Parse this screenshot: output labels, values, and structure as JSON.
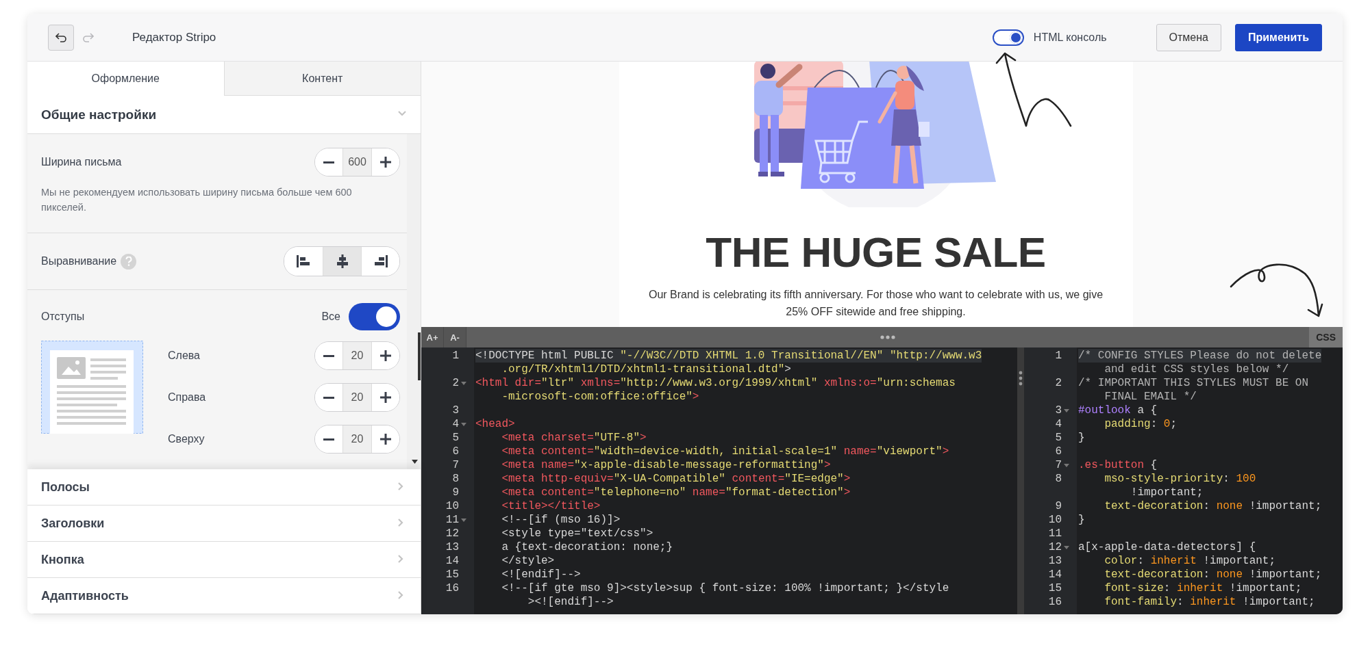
{
  "header": {
    "undo": {
      "disabled": false
    },
    "redo": {
      "disabled": true
    },
    "title": "Редактор Stripo",
    "console_toggle": {
      "label": "HTML консоль",
      "on": true
    },
    "buttons": [
      {
        "label": "Отмена",
        "kind": "secondary"
      },
      {
        "label": "Применить",
        "kind": "primary"
      }
    ]
  },
  "left_panel": {
    "tabs": [
      {
        "label": "Оформление",
        "selected": true
      },
      {
        "label": "Контент",
        "selected": false
      }
    ],
    "general": {
      "title": "Общие настройки",
      "expanded": true,
      "email_width": {
        "label": "Ширина письма",
        "value": "600",
        "hint": "Мы не рекомендуем использовать ширину письма больше чем 600 пикселей."
      },
      "alignment": {
        "label": "Выравнивание",
        "options": [
          {
            "kind": "left",
            "selected": false
          },
          {
            "kind": "center",
            "selected": true
          },
          {
            "kind": "right",
            "selected": false
          }
        ]
      },
      "paddings": {
        "label": "Отступы",
        "toggle": {
          "label": "Все",
          "on": true
        },
        "fields": [
          {
            "label": "Слева",
            "value": "20"
          },
          {
            "label": "Справа",
            "value": "20"
          },
          {
            "label": "Сверху",
            "value": "20"
          }
        ]
      }
    },
    "sections": [
      {
        "title": "Полосы",
        "expanded": false
      },
      {
        "title": "Заголовки",
        "expanded": false
      },
      {
        "title": "Кнопка",
        "expanded": false
      },
      {
        "title": "Адаптивность",
        "expanded": false
      }
    ]
  },
  "preview": {
    "title": "THE HUGE SALE",
    "text": "Our Brand is celebrating its fifth anniversary. For those who want to celebrate with us, we give 25% OFF sitewide and free shipping."
  },
  "code_editor": {
    "toolbar": {
      "buttons": [
        "A+",
        "A-"
      ],
      "css_tab": "CSS"
    },
    "html": {
      "lines": [
        {
          "n": "1",
          "fold": false,
          "active": true,
          "rows": [
            {
              "tokens": [
                {
                  "kind": "plain",
                  "text": "<!DOCTYPE html PUBLIC "
                },
                {
                  "kind": "string",
                  "text": "\"-//W3C//DTD XHTML 1.0 Transitional//EN\" \"http://www.w3"
                }
              ]
            },
            {
              "tokens": [
                {
                  "kind": "string",
                  "text": ".org/TR/xhtml1/DTD/xhtml1-transitional.dtd\""
                },
                {
                  "kind": "plain",
                  "text": ">"
                }
              ]
            }
          ]
        },
        {
          "n": "2",
          "fold": true,
          "active": false,
          "rows": [
            {
              "tokens": [
                {
                  "kind": "tag",
                  "text": "<html "
                },
                {
                  "kind": "attr",
                  "text": "dir="
                },
                {
                  "kind": "string",
                  "text": "\"ltr\" "
                },
                {
                  "kind": "attr",
                  "text": "xmlns="
                },
                {
                  "kind": "string",
                  "text": "\"http://www.w3.org/1999/xhtml\" "
                },
                {
                  "kind": "attr",
                  "text": "xmlns:o="
                },
                {
                  "kind": "string",
                  "text": "\"urn:schemas"
                }
              ]
            },
            {
              "tokens": [
                {
                  "kind": "string",
                  "text": "-microsoft-com:office:office\""
                },
                {
                  "kind": "tag",
                  "text": ">"
                }
              ]
            }
          ]
        },
        {
          "n": "3",
          "fold": false,
          "active": false
        },
        {
          "n": "4",
          "fold": true,
          "active": false,
          "rows": [
            {
              "tokens": [
                {
                  "kind": "tag",
                  "text": "<head>"
                }
              ]
            }
          ]
        },
        {
          "n": "5",
          "fold": false,
          "active": false,
          "rows": [
            {
              "tokens": [
                {
                  "kind": "tag",
                  "text": "    <meta "
                },
                {
                  "kind": "attr",
                  "text": "charset="
                },
                {
                  "kind": "string",
                  "text": "\"UTF-8\""
                },
                {
                  "kind": "tag",
                  "text": ">"
                }
              ]
            }
          ]
        },
        {
          "n": "6",
          "fold": false,
          "active": false,
          "rows": [
            {
              "tokens": [
                {
                  "kind": "tag",
                  "text": "    <meta "
                },
                {
                  "kind": "attr",
                  "text": "content="
                },
                {
                  "kind": "string",
                  "text": "\"width=device-width, initial-scale=1\" "
                },
                {
                  "kind": "attr",
                  "text": "name="
                },
                {
                  "kind": "string",
                  "text": "\"viewport\""
                },
                {
                  "kind": "tag",
                  "text": ">"
                }
              ]
            }
          ]
        },
        {
          "n": "7",
          "fold": false,
          "active": false,
          "rows": [
            {
              "tokens": [
                {
                  "kind": "tag",
                  "text": "    <meta "
                },
                {
                  "kind": "attr",
                  "text": "name="
                },
                {
                  "kind": "string",
                  "text": "\"x-apple-disable-message-reformatting\""
                },
                {
                  "kind": "tag",
                  "text": ">"
                }
              ]
            }
          ]
        },
        {
          "n": "8",
          "fold": false,
          "active": false,
          "rows": [
            {
              "tokens": [
                {
                  "kind": "tag",
                  "text": "    <meta "
                },
                {
                  "kind": "attr",
                  "text": "http-equiv="
                },
                {
                  "kind": "string",
                  "text": "\"X-UA-Compatible\" "
                },
                {
                  "kind": "attr",
                  "text": "content="
                },
                {
                  "kind": "string",
                  "text": "\"IE=edge\""
                },
                {
                  "kind": "tag",
                  "text": ">"
                }
              ]
            }
          ]
        },
        {
          "n": "9",
          "fold": false,
          "active": false,
          "rows": [
            {
              "tokens": [
                {
                  "kind": "tag",
                  "text": "    <meta "
                },
                {
                  "kind": "attr",
                  "text": "content="
                },
                {
                  "kind": "string",
                  "text": "\"telephone=no\" "
                },
                {
                  "kind": "attr",
                  "text": "name="
                },
                {
                  "kind": "string",
                  "text": "\"format-detection\""
                },
                {
                  "kind": "tag",
                  "text": ">"
                }
              ]
            }
          ]
        },
        {
          "n": "10",
          "fold": false,
          "active": false,
          "rows": [
            {
              "tokens": [
                {
                  "kind": "tag",
                  "text": "    <title></title>"
                }
              ]
            }
          ]
        },
        {
          "n": "11",
          "fold": true,
          "active": false,
          "rows": [
            {
              "tokens": [
                {
                  "kind": "plain",
                  "text": "    <!--[if (mso 16)]>"
                }
              ]
            }
          ]
        },
        {
          "n": "12",
          "fold": false,
          "active": false,
          "rows": [
            {
              "tokens": [
                {
                  "kind": "plain",
                  "text": "    <style type=\"text/css\">"
                }
              ]
            }
          ]
        },
        {
          "n": "13",
          "fold": false,
          "active": false,
          "rows": [
            {
              "tokens": [
                {
                  "kind": "plain",
                  "text": "    a {text-decoration: none;}"
                }
              ]
            }
          ]
        },
        {
          "n": "14",
          "fold": false,
          "active": false,
          "rows": [
            {
              "tokens": [
                {
                  "kind": "plain",
                  "text": "    </style>"
                }
              ]
            }
          ]
        },
        {
          "n": "15",
          "fold": false,
          "active": false,
          "rows": [
            {
              "tokens": [
                {
                  "kind": "plain",
                  "text": "    <![endif]-->"
                }
              ]
            }
          ]
        },
        {
          "n": "16",
          "fold": false,
          "active": false,
          "rows": [
            {
              "tokens": [
                {
                  "kind": "plain",
                  "text": "    <!--[if gte mso 9]><style>sup { font-size: 100% !important; }</style"
                }
              ]
            },
            {
              "tokens": [
                {
                  "kind": "plain",
                  "text": "    ><![endif]-->"
                }
              ]
            }
          ]
        }
      ]
    },
    "css": {
      "lines": [
        {
          "n": "1",
          "fold": false,
          "active": true,
          "rows": [
            {
              "tokens": [
                {
                  "kind": "comment",
                  "text": "/* CONFIG STYLES Please do not delete"
                }
              ]
            },
            {
              "tokens": [
                {
                  "kind": "comment",
                  "text": "and edit CSS styles below */"
                }
              ]
            }
          ]
        },
        {
          "n": "2",
          "fold": false,
          "active": false,
          "rows": [
            {
              "tokens": [
                {
                  "kind": "comment",
                  "text": "/* IMPORTANT THIS STYLES MUST BE ON"
                }
              ]
            },
            {
              "tokens": [
                {
                  "kind": "comment",
                  "text": "FINAL EMAIL */"
                }
              ]
            }
          ]
        },
        {
          "n": "3",
          "fold": true,
          "active": false,
          "rows": [
            {
              "tokens": [
                {
                  "kind": "selector_id",
                  "text": "#outlook"
                },
                {
                  "kind": "plain",
                  "text": " a {"
                }
              ]
            }
          ]
        },
        {
          "n": "4",
          "fold": false,
          "active": false,
          "rows": [
            {
              "tokens": [
                {
                  "kind": "property",
                  "text": "    padding"
                },
                {
                  "kind": "plain",
                  "text": ": "
                },
                {
                  "kind": "number",
                  "text": "0"
                },
                {
                  "kind": "plain",
                  "text": ";"
                }
              ]
            }
          ]
        },
        {
          "n": "5",
          "fold": false,
          "active": false,
          "rows": [
            {
              "tokens": [
                {
                  "kind": "plain",
                  "text": "}"
                }
              ]
            }
          ]
        },
        {
          "n": "6",
          "fold": false,
          "active": false
        },
        {
          "n": "7",
          "fold": true,
          "active": false,
          "rows": [
            {
              "tokens": [
                {
                  "kind": "selector_class",
                  "text": ".es-button"
                },
                {
                  "kind": "plain",
                  "text": " {"
                }
              ]
            }
          ]
        },
        {
          "n": "8",
          "fold": false,
          "active": false,
          "rows": [
            {
              "tokens": [
                {
                  "kind": "property",
                  "text": "    mso-style-priority"
                },
                {
                  "kind": "plain",
                  "text": ": "
                },
                {
                  "kind": "number",
                  "text": "100"
                }
              ]
            },
            {
              "tokens": [
                {
                  "kind": "plain",
                  "text": "    !important;"
                }
              ]
            }
          ]
        },
        {
          "n": "9",
          "fold": false,
          "active": false,
          "rows": [
            {
              "tokens": [
                {
                  "kind": "property",
                  "text": "    text-decoration"
                },
                {
                  "kind": "plain",
                  "text": ": "
                },
                {
                  "kind": "value",
                  "text": "none"
                },
                {
                  "kind": "plain",
                  "text": " !important;"
                }
              ]
            }
          ]
        },
        {
          "n": "10",
          "fold": false,
          "active": false,
          "rows": [
            {
              "tokens": [
                {
                  "kind": "plain",
                  "text": "}"
                }
              ]
            }
          ]
        },
        {
          "n": "11",
          "fold": false,
          "active": false
        },
        {
          "n": "12",
          "fold": true,
          "active": false,
          "rows": [
            {
              "tokens": [
                {
                  "kind": "plain",
                  "text": "a[x-apple-data-detectors] {"
                }
              ]
            }
          ]
        },
        {
          "n": "13",
          "fold": false,
          "active": false,
          "rows": [
            {
              "tokens": [
                {
                  "kind": "property",
                  "text": "    color"
                },
                {
                  "kind": "plain",
                  "text": ": "
                },
                {
                  "kind": "value",
                  "text": "inherit"
                },
                {
                  "kind": "plain",
                  "text": " !important;"
                }
              ]
            }
          ]
        },
        {
          "n": "14",
          "fold": false,
          "active": false,
          "rows": [
            {
              "tokens": [
                {
                  "kind": "property",
                  "text": "    text-decoration"
                },
                {
                  "kind": "plain",
                  "text": ": "
                },
                {
                  "kind": "value",
                  "text": "none"
                },
                {
                  "kind": "plain",
                  "text": " !important;"
                }
              ]
            }
          ]
        },
        {
          "n": "15",
          "fold": false,
          "active": false,
          "rows": [
            {
              "tokens": [
                {
                  "kind": "property",
                  "text": "    font-size"
                },
                {
                  "kind": "plain",
                  "text": ": "
                },
                {
                  "kind": "value",
                  "text": "inherit"
                },
                {
                  "kind": "plain",
                  "text": " !important;"
                }
              ]
            }
          ]
        },
        {
          "n": "16",
          "fold": false,
          "active": false,
          "rows": [
            {
              "tokens": [
                {
                  "kind": "property",
                  "text": "    font-family"
                },
                {
                  "kind": "plain",
                  "text": ": "
                },
                {
                  "kind": "value",
                  "text": "inherit"
                },
                {
                  "kind": "plain",
                  "text": " !important;"
                }
              ]
            }
          ]
        }
      ]
    }
  }
}
